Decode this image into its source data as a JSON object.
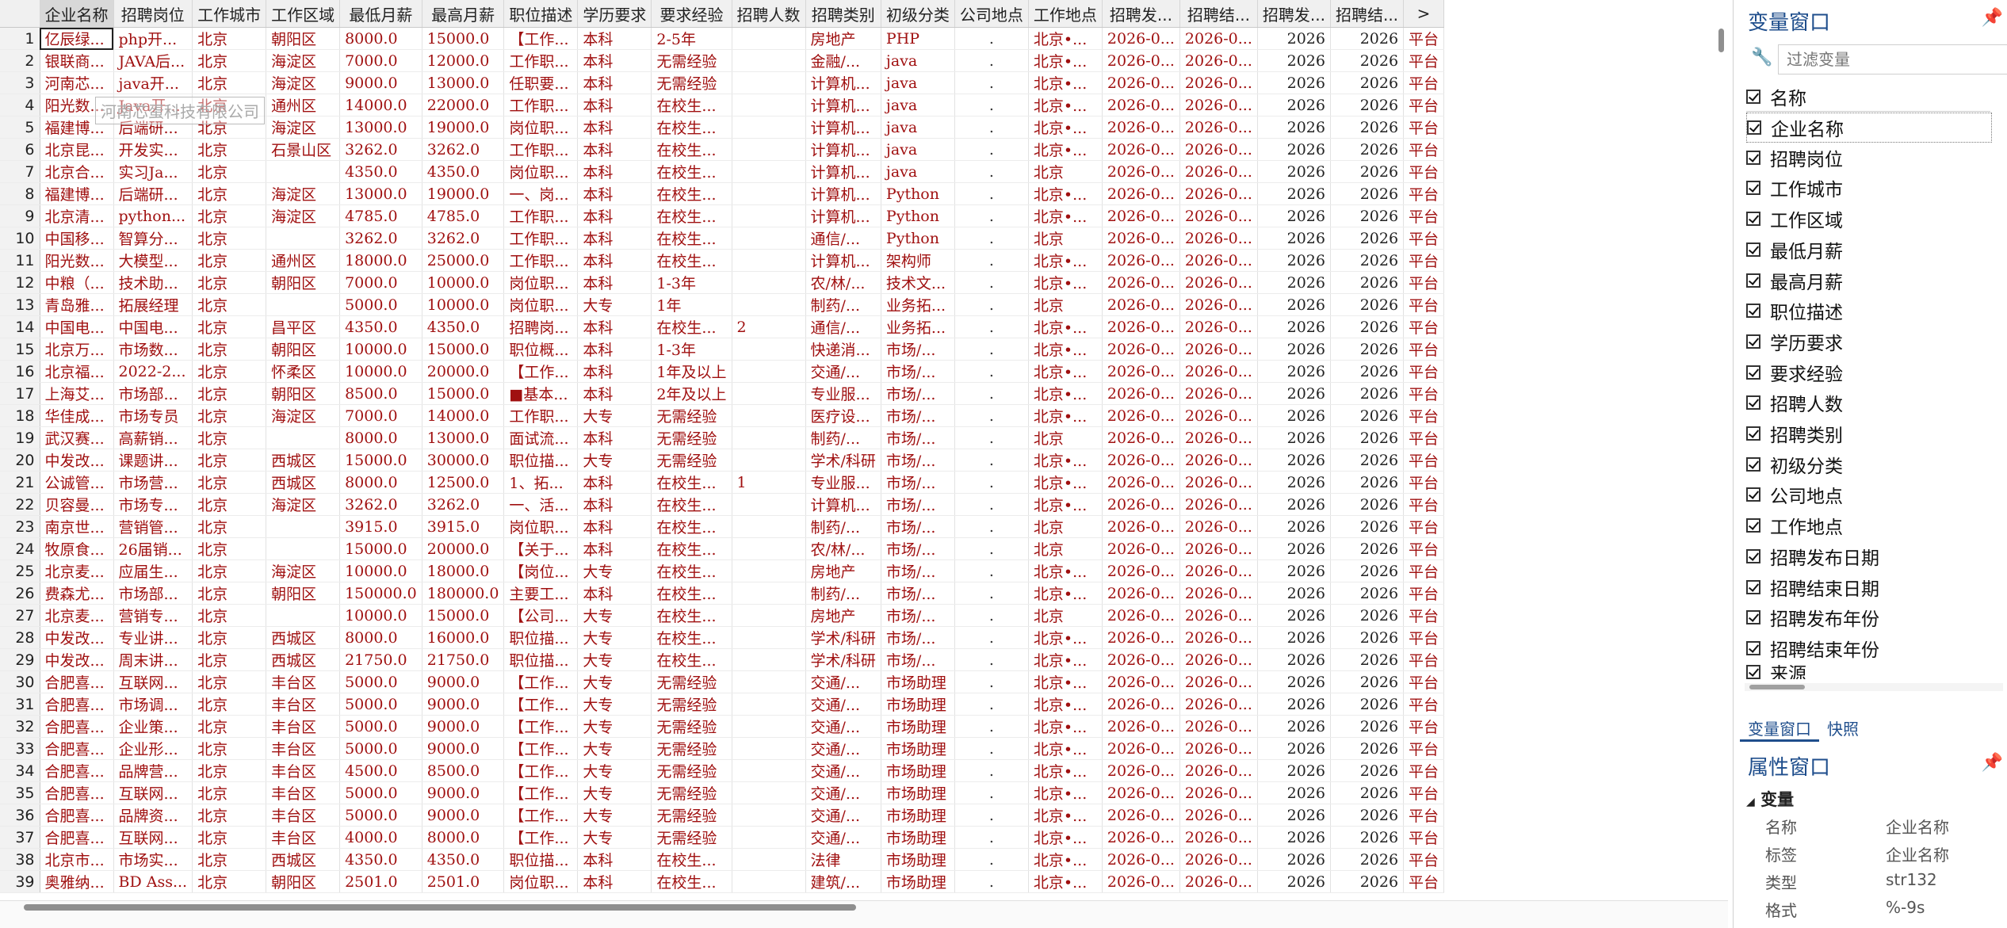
{
  "grid": {
    "columns": [
      "企业名称",
      "招聘岗位",
      "工作城市",
      "工作区域",
      "最低月薪",
      "最高月薪",
      "职位描述",
      "学历要求",
      "要求经验",
      "招聘人数",
      "招聘类别",
      "初级分类",
      "公司地点",
      "工作地点",
      "招聘发...",
      "招聘结...",
      "招聘发...",
      "招聘结...",
      ">"
    ],
    "rows": [
      [
        "1",
        "亿辰绿...",
        "php开...",
        "北京",
        "朝阳区",
        "8000.0",
        "15000.0",
        "【工作...",
        "本科",
        "2-5年",
        "",
        "房地产",
        "PHP",
        ".",
        "北京•...",
        "2026-0...",
        "2026-0...",
        "2026",
        "2026",
        "平台"
      ],
      [
        "2",
        "银联商...",
        "JAVA后...",
        "北京",
        "海淀区",
        "7000.0",
        "12000.0",
        "工作职...",
        "本科",
        "无需经验",
        "",
        "金融/...",
        "java",
        ".",
        "北京•...",
        "2026-0...",
        "2026-0...",
        "2026",
        "2026",
        "平台"
      ],
      [
        "3",
        "河南芯...",
        "java开...",
        "北京",
        "海淀区",
        "9000.0",
        "13000.0",
        "任职要...",
        "本科",
        "无需经验",
        "",
        "计算机...",
        "java",
        ".",
        "北京•...",
        "2026-0...",
        "2026-0...",
        "2026",
        "2026",
        "平台"
      ],
      [
        "4",
        "阳光数...",
        "Java开...",
        "北京",
        "通州区",
        "14000.0",
        "22000.0",
        "工作职...",
        "本科",
        "在校生...",
        "",
        "计算机...",
        "java",
        ".",
        "北京•...",
        "2026-0...",
        "2026-0...",
        "2026",
        "2026",
        "平台"
      ],
      [
        "5",
        "福建博...",
        "后端研...",
        "北京",
        "海淀区",
        "13000.0",
        "19000.0",
        "岗位职...",
        "本科",
        "在校生...",
        "",
        "计算机...",
        "java",
        ".",
        "北京•...",
        "2026-0...",
        "2026-0...",
        "2026",
        "2026",
        "平台"
      ],
      [
        "6",
        "北京昆...",
        "开发实...",
        "北京",
        "石景山区",
        "3262.0",
        "3262.0",
        "工作职...",
        "本科",
        "在校生...",
        "",
        "计算机...",
        "java",
        ".",
        "北京•...",
        "2026-0...",
        "2026-0...",
        "2026",
        "2026",
        "平台"
      ],
      [
        "7",
        "北京合...",
        "实习Ja...",
        "北京",
        "",
        "4350.0",
        "4350.0",
        "岗位职...",
        "本科",
        "在校生...",
        "",
        "计算机...",
        "java",
        ".",
        "北京",
        "2026-0...",
        "2026-0...",
        "2026",
        "2026",
        "平台"
      ],
      [
        "8",
        "福建博...",
        "后端研...",
        "北京",
        "海淀区",
        "13000.0",
        "19000.0",
        "一、岗...",
        "本科",
        "在校生...",
        "",
        "计算机...",
        "Python",
        ".",
        "北京•...",
        "2026-0...",
        "2026-0...",
        "2026",
        "2026",
        "平台"
      ],
      [
        "9",
        "北京清...",
        "python...",
        "北京",
        "海淀区",
        "4785.0",
        "4785.0",
        "工作职...",
        "本科",
        "在校生...",
        "",
        "计算机...",
        "Python",
        ".",
        "北京•...",
        "2026-0...",
        "2026-0...",
        "2026",
        "2026",
        "平台"
      ],
      [
        "10",
        "中国移...",
        "智算分...",
        "北京",
        "",
        "3262.0",
        "3262.0",
        "工作职...",
        "本科",
        "在校生...",
        "",
        "通信/...",
        "Python",
        ".",
        "北京",
        "2026-0...",
        "2026-0...",
        "2026",
        "2026",
        "平台"
      ],
      [
        "11",
        "阳光数...",
        "大模型...",
        "北京",
        "通州区",
        "18000.0",
        "25000.0",
        "工作职...",
        "本科",
        "在校生...",
        "",
        "计算机...",
        "架构师",
        ".",
        "北京•...",
        "2026-0...",
        "2026-0...",
        "2026",
        "2026",
        "平台"
      ],
      [
        "12",
        "中粮（...",
        "技术助...",
        "北京",
        "朝阳区",
        "7000.0",
        "10000.0",
        "岗位职...",
        "本科",
        "1-3年",
        "",
        "农/林/...",
        "技术文...",
        ".",
        "北京•...",
        "2026-0...",
        "2026-0...",
        "2026",
        "2026",
        "平台"
      ],
      [
        "13",
        "青岛雅...",
        "拓展经理",
        "北京",
        "",
        "5000.0",
        "10000.0",
        "岗位职...",
        "大专",
        "1年",
        "",
        "制药/...",
        "业务拓...",
        ".",
        "北京",
        "2026-0...",
        "2026-0...",
        "2026",
        "2026",
        "平台"
      ],
      [
        "14",
        "中国电...",
        "中国电...",
        "北京",
        "昌平区",
        "4350.0",
        "4350.0",
        "招聘岗...",
        "本科",
        "在校生...",
        "2",
        "通信/...",
        "业务拓...",
        ".",
        "北京•...",
        "2026-0...",
        "2026-0...",
        "2026",
        "2026",
        "平台"
      ],
      [
        "15",
        "北京万...",
        "市场数...",
        "北京",
        "朝阳区",
        "10000.0",
        "15000.0",
        "职位概...",
        "本科",
        "1-3年",
        "",
        "快递消...",
        "市场/...",
        ".",
        "北京•...",
        "2026-0...",
        "2026-0...",
        "2026",
        "2026",
        "平台"
      ],
      [
        "16",
        "北京福...",
        "2022-2...",
        "北京",
        "怀柔区",
        "10000.0",
        "20000.0",
        "【工作...",
        "本科",
        "1年及以上",
        "",
        "交通/...",
        "市场/...",
        ".",
        "北京•...",
        "2026-0...",
        "2026-0...",
        "2026",
        "2026",
        "平台"
      ],
      [
        "17",
        "上海艾...",
        "市场部...",
        "北京",
        "朝阳区",
        "8500.0",
        "15000.0",
        "■基本...",
        "本科",
        "2年及以上",
        "",
        "专业服...",
        "市场/...",
        ".",
        "北京•...",
        "2026-0...",
        "2026-0...",
        "2026",
        "2026",
        "平台"
      ],
      [
        "18",
        "华佳成...",
        "市场专员",
        "北京",
        "海淀区",
        "7000.0",
        "14000.0",
        "工作职...",
        "大专",
        "无需经验",
        "",
        "医疗设...",
        "市场/...",
        ".",
        "北京•...",
        "2026-0...",
        "2026-0...",
        "2026",
        "2026",
        "平台"
      ],
      [
        "19",
        "武汉赛...",
        "高薪销...",
        "北京",
        "",
        "8000.0",
        "13000.0",
        "面试流...",
        "本科",
        "无需经验",
        "",
        "制药/...",
        "市场/...",
        ".",
        "北京",
        "2026-0...",
        "2026-0...",
        "2026",
        "2026",
        "平台"
      ],
      [
        "20",
        "中发改...",
        "课题讲...",
        "北京",
        "西城区",
        "15000.0",
        "30000.0",
        "职位描...",
        "大专",
        "无需经验",
        "",
        "学术/科研",
        "市场/...",
        ".",
        "北京•...",
        "2026-0...",
        "2026-0...",
        "2026",
        "2026",
        "平台"
      ],
      [
        "21",
        "公诚管...",
        "市场营...",
        "北京",
        "西城区",
        "8000.0",
        "12500.0",
        "1、拓...",
        "本科",
        "在校生...",
        "1",
        "专业服...",
        "市场/...",
        ".",
        "北京•...",
        "2026-0...",
        "2026-0...",
        "2026",
        "2026",
        "平台"
      ],
      [
        "22",
        "贝容曼...",
        "市场专...",
        "北京",
        "海淀区",
        "3262.0",
        "3262.0",
        "一、活...",
        "本科",
        "在校生...",
        "",
        "计算机...",
        "市场/...",
        ".",
        "北京•...",
        "2026-0...",
        "2026-0...",
        "2026",
        "2026",
        "平台"
      ],
      [
        "23",
        "南京世...",
        "营销管...",
        "北京",
        "",
        "3915.0",
        "3915.0",
        "岗位职...",
        "本科",
        "在校生...",
        "",
        "制药/...",
        "市场/...",
        ".",
        "北京",
        "2026-0...",
        "2026-0...",
        "2026",
        "2026",
        "平台"
      ],
      [
        "24",
        "牧原食...",
        "26届销...",
        "北京",
        "",
        "15000.0",
        "20000.0",
        "【关于...",
        "本科",
        "在校生...",
        "",
        "农/林/...",
        "市场/...",
        ".",
        "北京",
        "2026-0...",
        "2026-0...",
        "2026",
        "2026",
        "平台"
      ],
      [
        "25",
        "北京麦...",
        "应届生...",
        "北京",
        "海淀区",
        "10000.0",
        "18000.0",
        "【岗位...",
        "大专",
        "在校生...",
        "",
        "房地产",
        "市场/...",
        ".",
        "北京•...",
        "2026-0...",
        "2026-0...",
        "2026",
        "2026",
        "平台"
      ],
      [
        "26",
        "费森尤...",
        "市场部...",
        "北京",
        "朝阳区",
        "150000.0",
        "180000.0",
        "主要工...",
        "本科",
        "在校生...",
        "",
        "制药/...",
        "市场/...",
        ".",
        "北京•...",
        "2026-0...",
        "2026-0...",
        "2026",
        "2026",
        "平台"
      ],
      [
        "27",
        "北京麦...",
        "营销专...",
        "北京",
        "",
        "10000.0",
        "15000.0",
        "【公司...",
        "大专",
        "在校生...",
        "",
        "房地产",
        "市场/...",
        ".",
        "北京",
        "2026-0...",
        "2026-0...",
        "2026",
        "2026",
        "平台"
      ],
      [
        "28",
        "中发改...",
        "专业讲...",
        "北京",
        "西城区",
        "8000.0",
        "16000.0",
        "职位描...",
        "大专",
        "在校生...",
        "",
        "学术/科研",
        "市场/...",
        ".",
        "北京•...",
        "2026-0...",
        "2026-0...",
        "2026",
        "2026",
        "平台"
      ],
      [
        "29",
        "中发改...",
        "周末讲...",
        "北京",
        "西城区",
        "21750.0",
        "21750.0",
        "职位描...",
        "大专",
        "在校生...",
        "",
        "学术/科研",
        "市场/...",
        ".",
        "北京•...",
        "2026-0...",
        "2026-0...",
        "2026",
        "2026",
        "平台"
      ],
      [
        "30",
        "合肥喜...",
        "互联网...",
        "北京",
        "丰台区",
        "5000.0",
        "9000.0",
        "【工作...",
        "大专",
        "无需经验",
        "",
        "交通/...",
        "市场助理",
        ".",
        "北京•...",
        "2026-0...",
        "2026-0...",
        "2026",
        "2026",
        "平台"
      ],
      [
        "31",
        "合肥喜...",
        "市场调...",
        "北京",
        "丰台区",
        "5000.0",
        "9000.0",
        "【工作...",
        "大专",
        "无需经验",
        "",
        "交通/...",
        "市场助理",
        ".",
        "北京•...",
        "2026-0...",
        "2026-0...",
        "2026",
        "2026",
        "平台"
      ],
      [
        "32",
        "合肥喜...",
        "企业策...",
        "北京",
        "丰台区",
        "5000.0",
        "9000.0",
        "【工作...",
        "大专",
        "无需经验",
        "",
        "交通/...",
        "市场助理",
        ".",
        "北京•...",
        "2026-0...",
        "2026-0...",
        "2026",
        "2026",
        "平台"
      ],
      [
        "33",
        "合肥喜...",
        "企业形...",
        "北京",
        "丰台区",
        "5000.0",
        "9000.0",
        "【工作...",
        "大专",
        "无需经验",
        "",
        "交通/...",
        "市场助理",
        ".",
        "北京•...",
        "2026-0...",
        "2026-0...",
        "2026",
        "2026",
        "平台"
      ],
      [
        "34",
        "合肥喜...",
        "品牌营...",
        "北京",
        "丰台区",
        "4500.0",
        "8500.0",
        "【工作...",
        "大专",
        "无需经验",
        "",
        "交通/...",
        "市场助理",
        ".",
        "北京•...",
        "2026-0...",
        "2026-0...",
        "2026",
        "2026",
        "平台"
      ],
      [
        "35",
        "合肥喜...",
        "互联网...",
        "北京",
        "丰台区",
        "5000.0",
        "9000.0",
        "【工作...",
        "大专",
        "无需经验",
        "",
        "交通/...",
        "市场助理",
        ".",
        "北京•...",
        "2026-0...",
        "2026-0...",
        "2026",
        "2026",
        "平台"
      ],
      [
        "36",
        "合肥喜...",
        "品牌资...",
        "北京",
        "丰台区",
        "5000.0",
        "9000.0",
        "【工作...",
        "大专",
        "无需经验",
        "",
        "交通/...",
        "市场助理",
        ".",
        "北京•...",
        "2026-0...",
        "2026-0...",
        "2026",
        "2026",
        "平台"
      ],
      [
        "37",
        "合肥喜...",
        "互联网...",
        "北京",
        "丰台区",
        "4000.0",
        "8000.0",
        "【工作...",
        "大专",
        "无需经验",
        "",
        "交通/...",
        "市场助理",
        ".",
        "北京•...",
        "2026-0...",
        "2026-0...",
        "2026",
        "2026",
        "平台"
      ],
      [
        "38",
        "北京市...",
        "市场实...",
        "北京",
        "西城区",
        "4350.0",
        "4350.0",
        "职位描...",
        "本科",
        "在校生...",
        "",
        "法律",
        "市场助理",
        ".",
        "北京•...",
        "2026-0...",
        "2026-0...",
        "2026",
        "2026",
        "平台"
      ],
      [
        "39",
        "奥雅纳...",
        "BD Ass...",
        "北京",
        "朝阳区",
        "2501.0",
        "2501.0",
        "岗位职...",
        "本科",
        "在校生...",
        "",
        "建筑/...",
        "市场助理",
        ".",
        "北京•...",
        "2026-0...",
        "2026-0...",
        "2026",
        "2026",
        "平台"
      ]
    ],
    "watermark": "河南芯蛋科技有限公司"
  },
  "variable_window": {
    "title": "变量窗口",
    "pin_icon": "pin-icon",
    "filter_placeholder": "过滤变量",
    "header_label": "名称",
    "variables": [
      "企业名称",
      "招聘岗位",
      "工作城市",
      "工作区域",
      "最低月薪",
      "最高月薪",
      "职位描述",
      "学历要求",
      "要求经验",
      "招聘人数",
      "招聘类别",
      "初级分类",
      "公司地点",
      "工作地点",
      "招聘发布日期",
      "招聘结束日期",
      "招聘发布年份",
      "招聘结束年份",
      "来源"
    ]
  },
  "tabs": [
    "变量窗口",
    "快照"
  ],
  "properties_window": {
    "title": "属性窗口",
    "section": "变量",
    "rows": [
      {
        "key": "名称",
        "value": "企业名称"
      },
      {
        "key": "标签",
        "value": "企业名称"
      },
      {
        "key": "类型",
        "value": "str132"
      },
      {
        "key": "格式",
        "value": "%-9s"
      }
    ]
  }
}
